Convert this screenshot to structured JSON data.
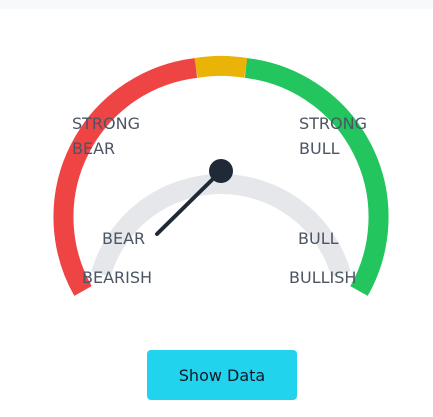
{
  "gauge": {
    "labels": {
      "strong_bear_line1": "STRONG",
      "strong_bear_line2": "BEAR",
      "strong_bull_line1": "STRONG",
      "strong_bull_line2": "BULL",
      "bear": "BEAR",
      "bull": "BULL",
      "bearish": "BEARISH",
      "bullish": "BULLISH"
    },
    "colors": {
      "bear_zone": "#ef4444",
      "neutral_zone": "#eab308",
      "bull_zone": "#22c55e",
      "inner_track": "#e5e7eb",
      "needle": "#1f2937"
    }
  },
  "actions": {
    "show_data_label": "Show Data"
  }
}
